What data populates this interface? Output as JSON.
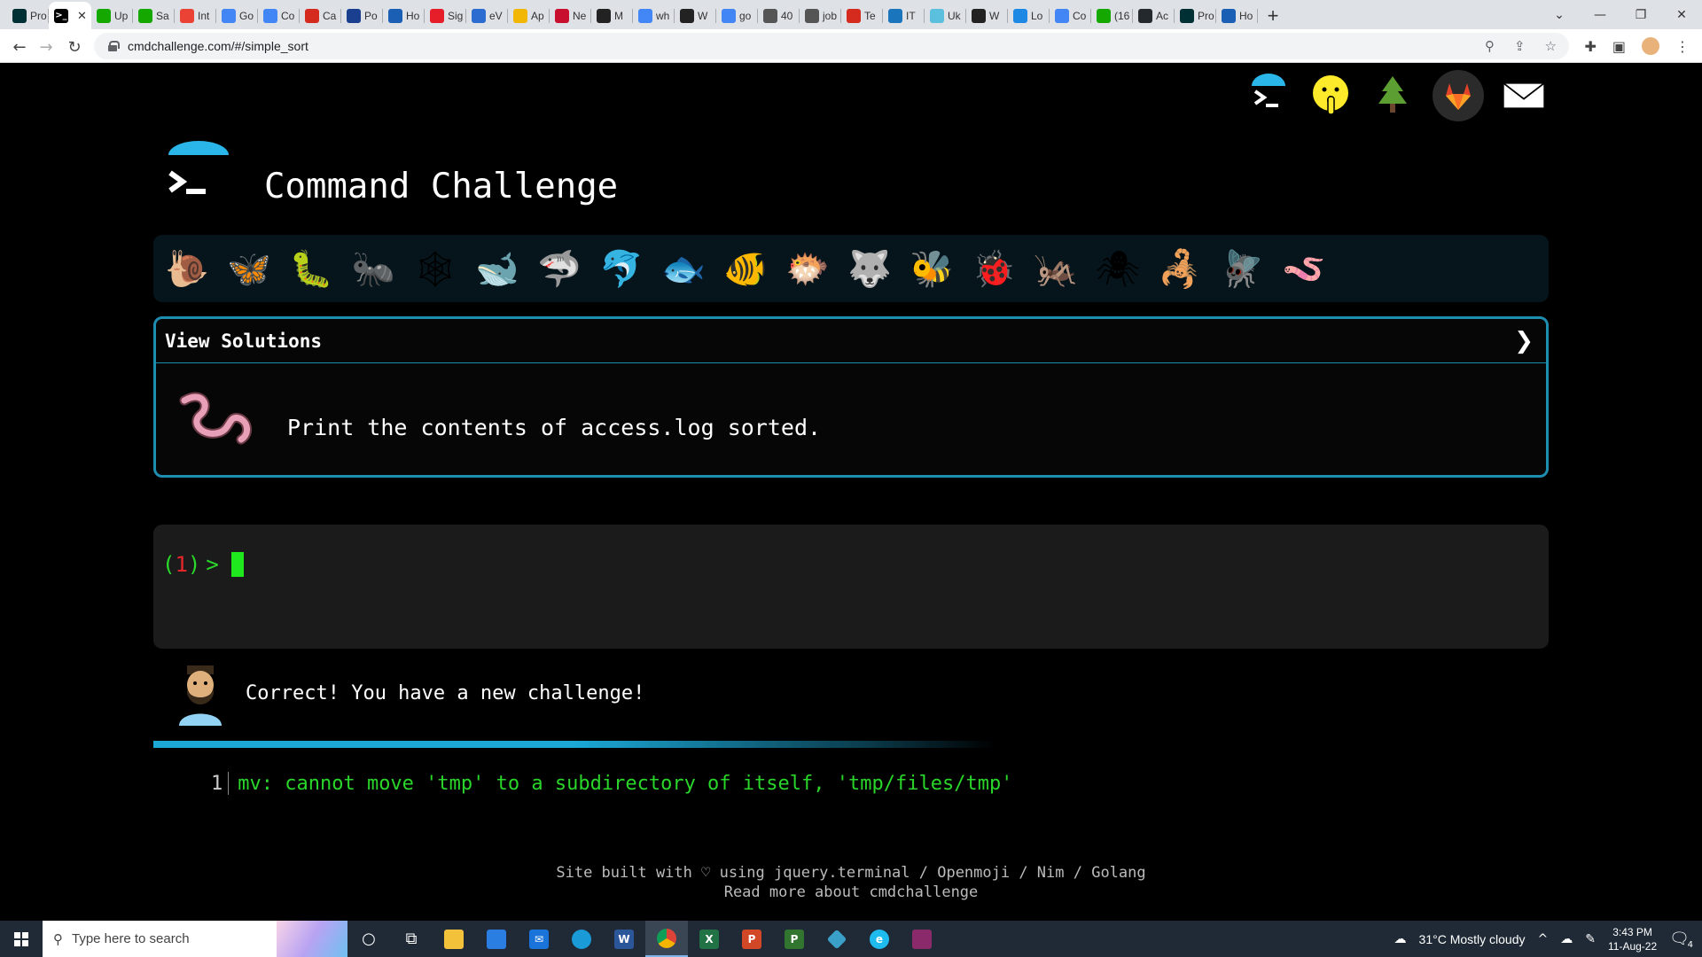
{
  "browser": {
    "tabs": [
      {
        "label": "Pro",
        "icon": "olx-icon",
        "color": "#002f34"
      },
      {
        "label": "",
        "icon": "terminal-icon",
        "color": "#000000",
        "active": true
      },
      {
        "label": "Up",
        "icon": "upwork-icon",
        "color": "#14a800"
      },
      {
        "label": "Sa",
        "icon": "upwork-icon",
        "color": "#14a800"
      },
      {
        "label": "Int",
        "icon": "gmail-icon",
        "color": "#ea4335"
      },
      {
        "label": "Go",
        "icon": "google-icon",
        "color": "#4285f4"
      },
      {
        "label": "Co",
        "icon": "google-icon",
        "color": "#4285f4"
      },
      {
        "label": "Ca",
        "icon": "maple-leaf-icon",
        "color": "#d52b1e"
      },
      {
        "label": "Po",
        "icon": "shield-icon",
        "color": "#1a3f8f"
      },
      {
        "label": "Ho",
        "icon": "hat-icon",
        "color": "#1a5fb4"
      },
      {
        "label": "Sig",
        "icon": "adobe-icon",
        "color": "#e61e2a"
      },
      {
        "label": "eV",
        "icon": "calendar-icon",
        "color": "#2b6cd1"
      },
      {
        "label": "Ap",
        "icon": "lightbulb-icon",
        "color": "#f2b705"
      },
      {
        "label": "Ne",
        "icon": "chart-icon",
        "color": "#c8102e"
      },
      {
        "label": "M",
        "icon": "tool-icon",
        "color": "#222222"
      },
      {
        "label": "wh",
        "icon": "google-icon",
        "color": "#4285f4"
      },
      {
        "label": "W",
        "icon": "box-icon",
        "color": "#222222"
      },
      {
        "label": "go",
        "icon": "google-icon",
        "color": "#4285f4"
      },
      {
        "label": "40",
        "icon": "circle-icon",
        "color": "#555555"
      },
      {
        "label": "job",
        "icon": "circle-icon",
        "color": "#555555"
      },
      {
        "label": "Te",
        "icon": "maple-leaf-icon",
        "color": "#d52b1e"
      },
      {
        "label": "IT",
        "icon": "js-icon",
        "color": "#1b75bc"
      },
      {
        "label": "Uk",
        "icon": "cloud-icon",
        "color": "#5bc0de"
      },
      {
        "label": "W",
        "icon": "box-icon",
        "color": "#222222"
      },
      {
        "label": "Lo",
        "icon": "ring-icon",
        "color": "#1e88e5"
      },
      {
        "label": "Co",
        "icon": "google-icon",
        "color": "#4285f4"
      },
      {
        "label": "(16",
        "icon": "upwork-icon",
        "color": "#14a800"
      },
      {
        "label": "Ac",
        "icon": "github-icon",
        "color": "#24292e"
      },
      {
        "label": "Pro",
        "icon": "olx-icon",
        "color": "#002f34"
      },
      {
        "label": "Ho",
        "icon": "hat-icon",
        "color": "#1a5fb4"
      }
    ],
    "url": "cmdchallenge.com/#/simple_sort"
  },
  "header": {
    "title": "Command Challenge",
    "top_icons": [
      {
        "name": "terminal-logo-icon"
      },
      {
        "name": "shushing-face-icon",
        "glyph": "🤭"
      },
      {
        "name": "tree-icon",
        "glyph": "🌲"
      },
      {
        "name": "gitlab-icon"
      },
      {
        "name": "envelope-icon",
        "glyph": "✉"
      }
    ]
  },
  "challenges": [
    {
      "name": "snail-icon",
      "glyph": "🐌"
    },
    {
      "name": "butterfly-icon",
      "glyph": "🦋"
    },
    {
      "name": "caterpillar-icon",
      "glyph": "🐛"
    },
    {
      "name": "ant-icon",
      "glyph": "🐜"
    },
    {
      "name": "spider-web-icon",
      "glyph": "🕸"
    },
    {
      "name": "whale-icon",
      "glyph": "🐋"
    },
    {
      "name": "shark-icon",
      "glyph": "🦈"
    },
    {
      "name": "dolphin-icon",
      "glyph": "🐬"
    },
    {
      "name": "fish-icon",
      "glyph": "🐟"
    },
    {
      "name": "tropical-fish-icon",
      "glyph": "🐠"
    },
    {
      "name": "blowfish-icon",
      "glyph": "🐡"
    },
    {
      "name": "wolf-icon",
      "glyph": "🐺"
    },
    {
      "name": "bee-icon",
      "glyph": "🐝"
    },
    {
      "name": "ladybug-icon",
      "glyph": "🐞"
    },
    {
      "name": "cricket-icon",
      "glyph": "🦗"
    },
    {
      "name": "spider-icon",
      "glyph": "🕷"
    },
    {
      "name": "scorpion-icon",
      "glyph": "🦂"
    },
    {
      "name": "fly-icon",
      "glyph": "🪰"
    },
    {
      "name": "worm-icon",
      "glyph": "🪱"
    }
  ],
  "panel": {
    "title": "View Solutions",
    "chevron": "❯",
    "description": "Print the contents of access.log sorted."
  },
  "terminal": {
    "prompt_open": "(",
    "prompt_num": "1",
    "prompt_close": ")",
    "prompt_arrow": ">"
  },
  "feedback": {
    "message": "Correct! You have a new challenge!",
    "progress": 0.5
  },
  "output": {
    "line_number": "1",
    "text": "mv: cannot move 'tmp' to a subdirectory of itself, 'tmp/files/tmp'"
  },
  "footer": {
    "line1": "Site built with ♡ using jquery.terminal / Openmoji / Nim / Golang",
    "line2": "Read more about cmdchallenge"
  },
  "taskbar": {
    "search_placeholder": "Type here to search",
    "weather": "31°C  Mostly cloudy",
    "time": "3:43 PM",
    "date": "11-Aug-22",
    "notifications": "4"
  },
  "colors": {
    "accent": "#1e8eb0",
    "prompt_green": "#2bd92b",
    "prompt_red": "#e8262b"
  }
}
